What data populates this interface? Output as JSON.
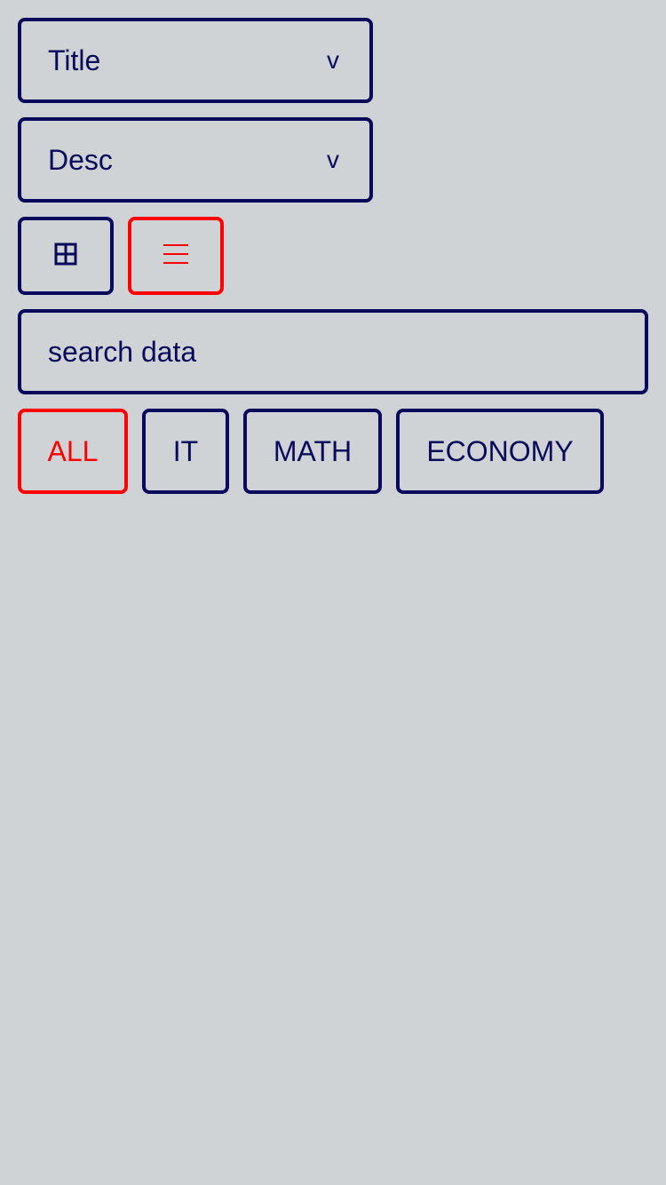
{
  "sort": {
    "field_value": "Title",
    "order_value": "Desc",
    "chevron": "v"
  },
  "view_toggle": {
    "grid_icon": "grid-icon",
    "list_icon": "list-icon",
    "active": "list"
  },
  "search": {
    "placeholder": "search data",
    "value": ""
  },
  "categories": {
    "all": "ALL",
    "it": "IT",
    "math": "MATH",
    "economy": "ECONOMY",
    "active": "ALL"
  },
  "colors": {
    "background": "#d0d3d6",
    "primary": "#0a0a5c",
    "active": "#ff0000"
  }
}
